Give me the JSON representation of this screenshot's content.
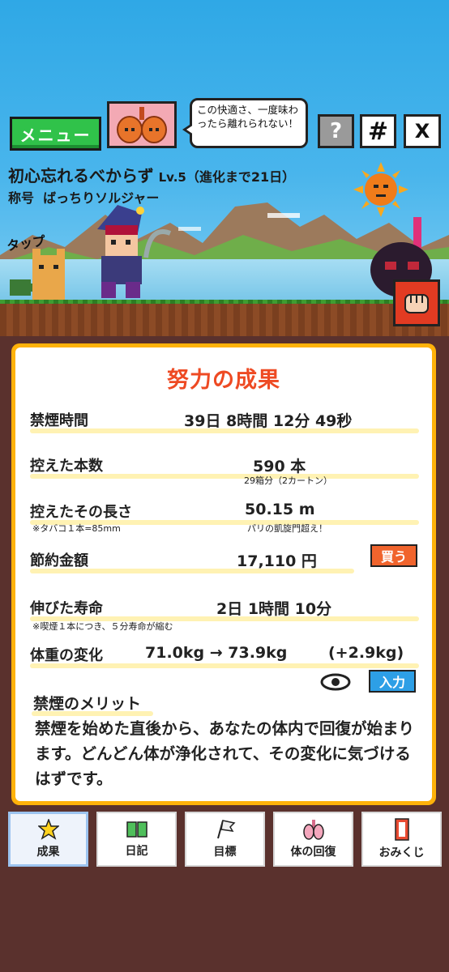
{
  "header": {
    "menu_label": "メニュー",
    "speech": "この快適さ、一度味わったら離れられない！",
    "help_label": "?",
    "hash_label": "#",
    "x_label": "X"
  },
  "character": {
    "title": "初心忘れるべからず",
    "level": "Lv.5",
    "evolve": "（進化まで21日）",
    "rank_prefix": "称号",
    "rank": "ばっちりソルジャー",
    "tap_label": "タップ"
  },
  "card": {
    "title": "努力の成果",
    "quit_time": {
      "label": "禁煙時間",
      "value": "39日  8時間  12分  49秒"
    },
    "not_smoked": {
      "label": "控えた本数",
      "value": "590  本",
      "note": "29箱分（2カートン）"
    },
    "length": {
      "label": "控えたその長さ",
      "value": "50.15  m",
      "note_left": "※タバコ１本=85mm",
      "note_right": "パリの凱旋門超え！"
    },
    "savings": {
      "label": "節約金額",
      "value": "17,110  円",
      "buy_label": "買う"
    },
    "life": {
      "label": "伸びた寿命",
      "value": "2日  1時間  10分",
      "note": "※喫煙１本につき、５分寿命が縮む"
    },
    "weight": {
      "label": "体重の変化",
      "value": "71.0kg  →  73.9kg",
      "diff": "(+2.9kg)",
      "input_label": "入力"
    },
    "merit": {
      "title": "禁煙のメリット",
      "text": "禁煙を始めた直後から、あなたの体内で回復が始まります。どんどん体が浄化されて、その変化に気づけるはずです。"
    }
  },
  "nav": {
    "items": [
      {
        "label": "成果",
        "icon": "star-icon"
      },
      {
        "label": "日記",
        "icon": "book-icon"
      },
      {
        "label": "目標",
        "icon": "flag-icon"
      },
      {
        "label": "体の回復",
        "icon": "lungs-icon"
      },
      {
        "label": "おみくじ",
        "icon": "omikuji-icon"
      }
    ]
  },
  "colors": {
    "accent_red": "#ee4a23",
    "card_border": "#ffb20a",
    "menu_green": "#30c24a",
    "buy_orange": "#f0642d",
    "input_blue": "#2d9fe6"
  }
}
